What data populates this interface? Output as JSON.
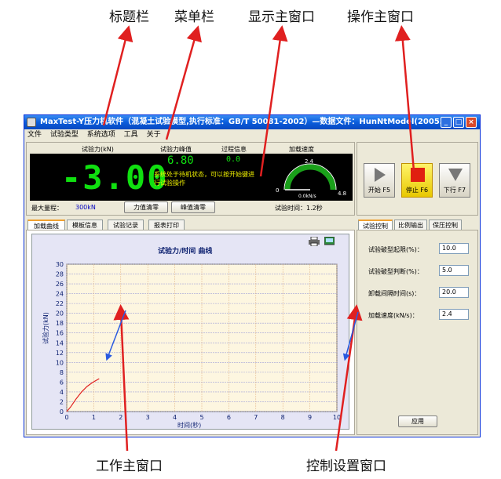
{
  "annotations": {
    "title_bar": "标题栏",
    "menu_bar": "菜单栏",
    "display_window": "显示主窗口",
    "operation_window": "操作主窗口",
    "work_window": "工作主窗口",
    "control_window": "控制设置窗口"
  },
  "window": {
    "title": "MaxTest-Y压力机软件（混凝土试验模型,执行标准：GB/T 50081-2002）—数据文件：HunNtModel(2005...",
    "buttons": [
      "_",
      "□",
      "×"
    ]
  },
  "menu": [
    "文件",
    "试验类型",
    "系统选项",
    "工具",
    "关于"
  ],
  "display": {
    "force_label": "试验力(kN)",
    "peak_label": "试验力峰值",
    "process_label": "过程信息",
    "speed_label": "加载速度",
    "force_value": "-3.00",
    "peak_value": "6.80",
    "process_value": "0.0",
    "status_message": "系统处于待机状态，可以按开始键进行试验操作",
    "gauge": {
      "max_tick": "2.4",
      "min_tick": "0",
      "end_tick": "4.8",
      "reading": "0.0kN/s",
      "value": 0
    },
    "range_label": "最大量程：",
    "range_value": "300kN",
    "zero_force_button": "力值清零",
    "zero_peak_button": "峰值清零",
    "test_time": "试验时间：1.2秒"
  },
  "operation": {
    "start": "开始 F5",
    "stop": "停止 F6",
    "down": "下行 F7"
  },
  "work_tabs": [
    "加载曲线",
    "模板信息",
    "试验记录",
    "报表打印"
  ],
  "control_tabs": [
    "试验控制",
    "比例输出",
    "保压控制"
  ],
  "control": {
    "fields": [
      {
        "label": "试验破型起限(%)：",
        "value": "10.0"
      },
      {
        "label": "试验破型判断(%)：",
        "value": "5.0"
      },
      {
        "label": "卸载间隔时间(s)：",
        "value": "20.0"
      },
      {
        "label": "加载速度(kN/s)：",
        "value": "2.4"
      }
    ],
    "apply": "应用"
  },
  "chart_data": {
    "type": "line",
    "title": "试验力/时间 曲线",
    "xlabel": "时间(秒)",
    "ylabel": "试验力(kN)",
    "xlim": [
      0,
      10
    ],
    "ylim": [
      0,
      30
    ],
    "xticks": [
      0,
      1,
      2,
      3,
      4,
      5,
      6,
      7,
      8,
      9,
      10
    ],
    "yticks": [
      0,
      2,
      4,
      6,
      8,
      10,
      12,
      14,
      16,
      18,
      20,
      22,
      24,
      26,
      28,
      30
    ],
    "grid": true,
    "series": [
      {
        "x": [
          0,
          0.15,
          0.35,
          0.55,
          0.75,
          0.95,
          1.2
        ],
        "y": [
          0,
          1.0,
          2.6,
          4.0,
          5.1,
          5.9,
          6.7
        ],
        "color": "#e02020"
      }
    ]
  }
}
